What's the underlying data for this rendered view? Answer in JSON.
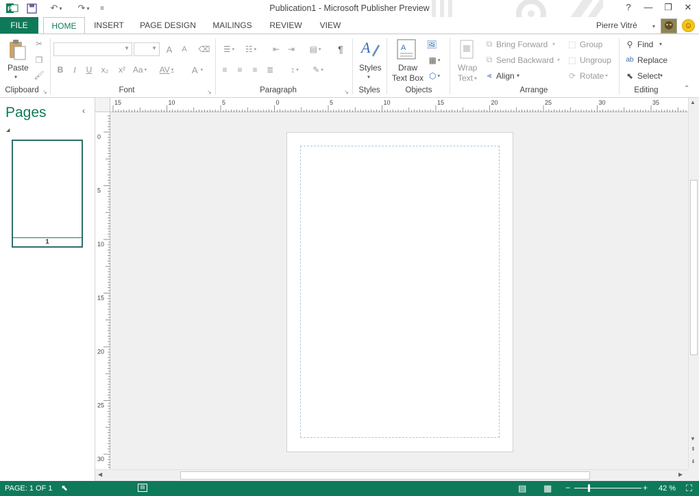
{
  "app": {
    "window_title": "Publication1 - Microsoft Publisher Preview",
    "user_name": "Pierre Vitré",
    "accent_color": "#0f7a5a"
  },
  "window_controls": {
    "help": "?",
    "minimize": "—",
    "restore": "❐",
    "close": "✕"
  },
  "tabs": [
    {
      "label": "FILE"
    },
    {
      "label": "HOME"
    },
    {
      "label": "INSERT"
    },
    {
      "label": "PAGE DESIGN"
    },
    {
      "label": "MAILINGS"
    },
    {
      "label": "REVIEW"
    },
    {
      "label": "VIEW"
    }
  ],
  "ribbon": {
    "clipboard": {
      "paste_label": "Paste",
      "group_label": "Clipboard"
    },
    "font": {
      "font_name": "",
      "font_size": "",
      "group_label": "Font",
      "bold": "B",
      "italic": "I",
      "underline": "U",
      "subscript": "x₂",
      "superscript": "x²",
      "change_case": "Aa",
      "char_spacing": "AV",
      "font_color": "A",
      "grow": "A",
      "shrink": "A"
    },
    "paragraph": {
      "group_label": "Paragraph",
      "pilcrow": "¶"
    },
    "styles": {
      "label": "Styles",
      "group_label": "Styles"
    },
    "objects": {
      "draw_text_box_line1": "Draw",
      "draw_text_box_line2": "Text Box",
      "group_label": "Objects"
    },
    "arrange": {
      "wrap_line1": "Wrap",
      "wrap_line2": "Text",
      "bring_forward": "Bring Forward",
      "send_backward": "Send Backward",
      "align": "Align",
      "group": "Group",
      "ungroup": "Ungroup",
      "rotate": "Rotate",
      "group_label": "Arrange"
    },
    "editing": {
      "find": "Find",
      "replace": "Replace",
      "select": "Select",
      "group_label": "Editing"
    }
  },
  "pages_pane": {
    "title": "Pages",
    "thumbnails": [
      {
        "number": "1"
      }
    ]
  },
  "rulers": {
    "horizontal_labels": [
      "15",
      "10",
      "5",
      "0",
      "5",
      "10",
      "15",
      "20",
      "25",
      "30",
      "35"
    ],
    "vertical_labels": [
      "0",
      "5",
      "10",
      "15",
      "20",
      "25",
      "30"
    ]
  },
  "status": {
    "page_indicator": "PAGE: 1 OF 1",
    "zoom": "42 %",
    "zoom_level": 0.42
  }
}
